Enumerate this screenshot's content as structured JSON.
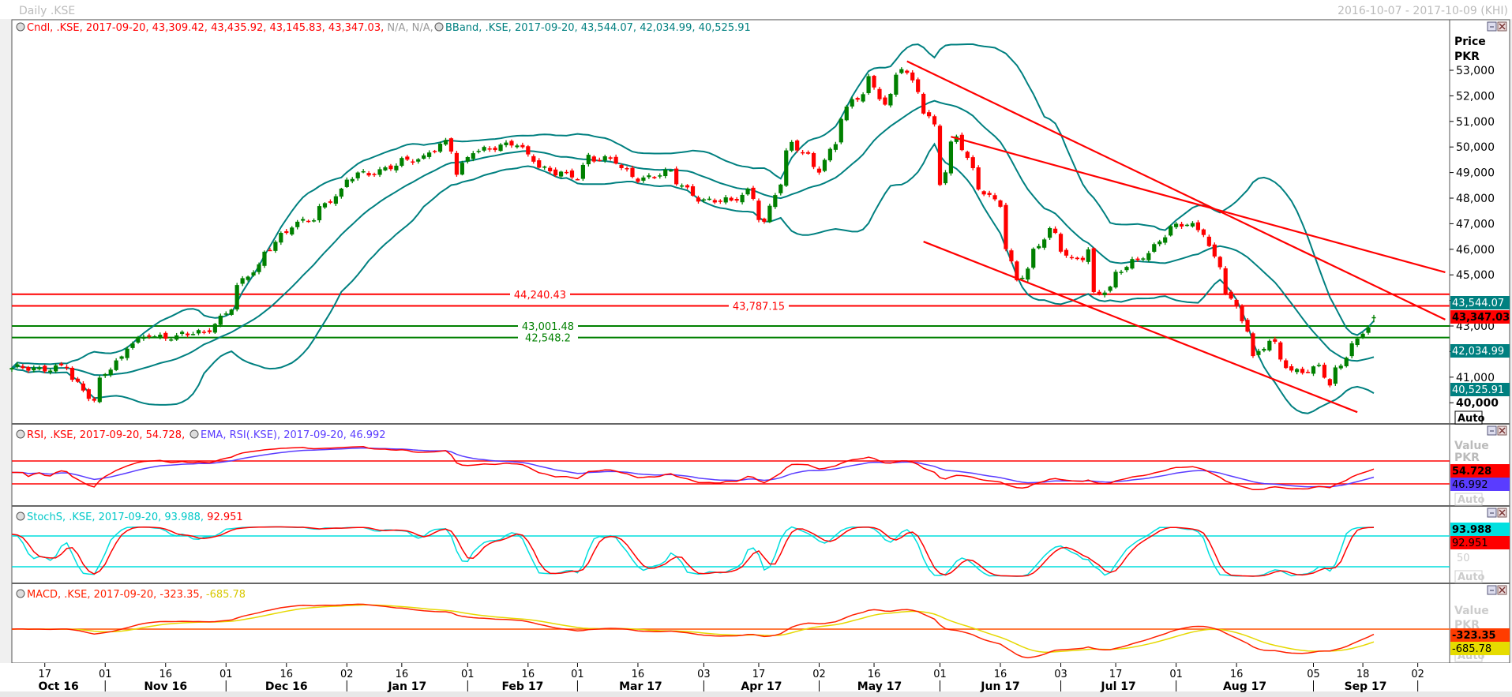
{
  "window": {
    "title": "Daily .KSE",
    "date_range": "2016-10-07 - 2017-10-09 (KHI)"
  },
  "colors": {
    "up": "#008000",
    "down": "#ff0000",
    "band": "#008080",
    "rsi": "#ff0000",
    "rsi_ema": "#5a3cff",
    "stoch_k": "#00dede",
    "stoch_d": "#ff0000",
    "macd": "#ff2000",
    "macd_signal": "#e6d800",
    "trend": "#ff0000",
    "support": "#008000"
  },
  "main_panel": {
    "legend_cndl": "Cndl, .KSE, 2017-09-20, 43,309.42, 43,435.92, 43,145.83, 43,347.03,",
    "legend_na": "N/A, N/A,",
    "legend_bband": "BBand, .KSE, 2017-09-20, 43,544.07, 42,034.99, 40,525.91",
    "axis_title": "Price",
    "axis_unit": "PKR",
    "auto_label": "Auto",
    "tags": {
      "bb_upper": "43,544.07",
      "last": "43,347.03",
      "bb_mid": "42,034.99",
      "bb_lower": "40,525.91"
    },
    "y_ticks": [
      "53,000",
      "52,000",
      "51,000",
      "50,000",
      "49,000",
      "48,000",
      "47,000",
      "46,000",
      "45,000",
      "44,000",
      "43,000",
      "42,000",
      "41,000",
      "40,000"
    ],
    "hlines": [
      {
        "label": "44,240.43",
        "value": 44240.43,
        "color": "red"
      },
      {
        "label": "43,787.15",
        "value": 43787.15,
        "color": "red"
      },
      {
        "label": "43,001.48",
        "value": 43001.48,
        "color": "green"
      },
      {
        "label": "42,548.2",
        "value": 42548.2,
        "color": "green"
      }
    ]
  },
  "rsi_panel": {
    "legend_rsi": "RSI, .KSE, 2017-09-20, 54.728,",
    "legend_ema": "EMA, RSI(.KSE), 2017-09-20, 46.992",
    "axis_title": "Value",
    "axis_unit": "PKR",
    "auto_label": "Auto",
    "tag_rsi": "54.728",
    "tag_ema": "46.992"
  },
  "stoch_panel": {
    "legend_k": "StochS, .KSE, 2017-09-20, 93.988,",
    "legend_d": "92.951",
    "tag_k": "93.988",
    "tag_d": "92.951",
    "mid_label": "50",
    "auto_label": "Auto"
  },
  "macd_panel": {
    "legend_macd": "MACD, .KSE, 2017-09-20, -323.35,",
    "legend_signal": "-685.78",
    "axis_title": "Value",
    "axis_unit": "PKR",
    "auto_label": "Auto",
    "tag_macd": "-323.35",
    "tag_signal": "-685.78"
  },
  "x_axis": {
    "minor": [
      {
        "label": "17",
        "date": "2016-10-17"
      },
      {
        "label": "01",
        "date": "2016-11-01"
      },
      {
        "label": "16",
        "date": "2016-11-16"
      },
      {
        "label": "01",
        "date": "2016-12-01"
      },
      {
        "label": "16",
        "date": "2016-12-16"
      },
      {
        "label": "02",
        "date": "2017-01-02"
      },
      {
        "label": "16",
        "date": "2017-01-16"
      },
      {
        "label": "01",
        "date": "2017-02-01"
      },
      {
        "label": "16",
        "date": "2017-02-16"
      },
      {
        "label": "01",
        "date": "2017-03-01"
      },
      {
        "label": "16",
        "date": "2017-03-16"
      },
      {
        "label": "03",
        "date": "2017-04-03"
      },
      {
        "label": "17",
        "date": "2017-04-17"
      },
      {
        "label": "02",
        "date": "2017-05-02"
      },
      {
        "label": "16",
        "date": "2017-05-16"
      },
      {
        "label": "01",
        "date": "2017-06-01"
      },
      {
        "label": "16",
        "date": "2017-06-16"
      },
      {
        "label": "03",
        "date": "2017-07-03"
      },
      {
        "label": "17",
        "date": "2017-07-17"
      },
      {
        "label": "01",
        "date": "2017-08-01"
      },
      {
        "label": "16",
        "date": "2017-08-16"
      },
      {
        "label": "05",
        "date": "2017-09-05"
      },
      {
        "label": "18",
        "date": "2017-09-18"
      },
      {
        "label": "02",
        "date": "2017-10-02"
      }
    ],
    "months": [
      {
        "label": "Oct 16",
        "start": "2016-10-07"
      },
      {
        "label": "Nov 16",
        "start": "2016-11-01"
      },
      {
        "label": "Dec 16",
        "start": "2016-12-01"
      },
      {
        "label": "Jan 17",
        "start": "2017-01-02"
      },
      {
        "label": "Feb 17",
        "start": "2017-02-01"
      },
      {
        "label": "Mar 17",
        "start": "2017-03-01"
      },
      {
        "label": "Apr 17",
        "start": "2017-04-03"
      },
      {
        "label": "May 17",
        "start": "2017-05-02"
      },
      {
        "label": "Jun 17",
        "start": "2017-06-01"
      },
      {
        "label": "Jul 17",
        "start": "2017-07-03"
      },
      {
        "label": "Aug 17",
        "start": "2017-08-01"
      },
      {
        "label": "Sep 17",
        "start": "2017-09-05"
      },
      {
        "label": "",
        "start": "2017-10-02"
      }
    ]
  },
  "chart_data": {
    "type": "candlestick",
    "title": "Daily .KSE",
    "instrument": ".KSE",
    "currency": "PKR",
    "x_range": [
      "2016-10-07",
      "2017-10-09"
    ],
    "ylim": [
      39200,
      54900
    ],
    "last_bar": {
      "date": "2017-09-20",
      "open": 43309.42,
      "high": 43435.92,
      "low": 43145.83,
      "close": 43347.03
    },
    "bollinger_last": {
      "upper": 43544.07,
      "middle": 42034.99,
      "lower": 40525.91
    },
    "rsi_last": 54.728,
    "rsi_ema_last": 46.992,
    "stoch_last": {
      "k": 93.988,
      "d": 92.951
    },
    "macd_last": {
      "macd": -323.35,
      "signal": -685.78
    },
    "rsi_levels": [
      70,
      30
    ],
    "stoch_levels": [
      80,
      20
    ],
    "close_anchors": [
      [
        "2016-10-07",
        41300
      ],
      [
        "2016-10-21",
        41400
      ],
      [
        "2016-10-28",
        40100
      ],
      [
        "2016-11-01",
        41240
      ],
      [
        "2016-11-11",
        42750
      ],
      [
        "2016-11-18",
        42500
      ],
      [
        "2016-11-28",
        42940
      ],
      [
        "2016-12-02",
        43680
      ],
      [
        "2016-12-07",
        45000
      ],
      [
        "2016-12-15",
        46500
      ],
      [
        "2016-12-23",
        47270
      ],
      [
        "2016-12-30",
        48200
      ],
      [
        "2017-01-04",
        48960
      ],
      [
        "2017-01-10",
        49100
      ],
      [
        "2017-01-19",
        49540
      ],
      [
        "2017-01-26",
        50160
      ],
      [
        "2017-01-30",
        48900
      ],
      [
        "2017-02-02",
        49900
      ],
      [
        "2017-02-14",
        50080
      ],
      [
        "2017-02-16",
        49700
      ],
      [
        "2017-02-23",
        48960
      ],
      [
        "2017-03-01",
        48800
      ],
      [
        "2017-03-03",
        49700
      ],
      [
        "2017-03-09",
        49500
      ],
      [
        "2017-03-16",
        48770
      ],
      [
        "2017-03-24",
        49000
      ],
      [
        "2017-03-31",
        48030
      ],
      [
        "2017-04-10",
        47800
      ],
      [
        "2017-04-13",
        48300
      ],
      [
        "2017-04-18",
        47070
      ],
      [
        "2017-04-20",
        48150
      ],
      [
        "2017-04-25",
        50100
      ],
      [
        "2017-05-02",
        49150
      ],
      [
        "2017-05-05",
        50100
      ],
      [
        "2017-05-10",
        51800
      ],
      [
        "2017-05-15",
        52730
      ],
      [
        "2017-05-18",
        51600
      ],
      [
        "2017-05-23",
        53100
      ],
      [
        "2017-05-26",
        52300
      ],
      [
        "2017-05-31",
        50850
      ],
      [
        "2017-06-01",
        48580
      ],
      [
        "2017-06-06",
        50400
      ],
      [
        "2017-06-09",
        49150
      ],
      [
        "2017-06-14",
        48030
      ],
      [
        "2017-06-16",
        47700
      ],
      [
        "2017-06-21",
        44800
      ],
      [
        "2017-06-29",
        46700
      ],
      [
        "2017-07-05",
        45560
      ],
      [
        "2017-07-10",
        46040
      ],
      [
        "2017-07-11",
        44260
      ],
      [
        "2017-07-14",
        44400
      ],
      [
        "2017-07-20",
        45560
      ],
      [
        "2017-07-25",
        45880
      ],
      [
        "2017-07-28",
        46500
      ],
      [
        "2017-08-03",
        47070
      ],
      [
        "2017-08-08",
        46700
      ],
      [
        "2017-08-10",
        45560
      ],
      [
        "2017-08-16",
        43680
      ],
      [
        "2017-08-21",
        41800
      ],
      [
        "2017-08-24",
        42400
      ],
      [
        "2017-08-30",
        41240
      ],
      [
        "2017-09-06",
        41400
      ],
      [
        "2017-09-08",
        40650
      ],
      [
        "2017-09-12",
        41400
      ],
      [
        "2017-09-14",
        42360
      ],
      [
        "2017-09-18",
        42800
      ],
      [
        "2017-09-20",
        43347.03
      ]
    ],
    "trend_lines": [
      {
        "from": [
          "2017-05-24",
          53350
        ],
        "to": [
          "2017-10-09",
          43250
        ]
      },
      {
        "from": [
          "2017-06-05",
          50400
        ],
        "to": [
          "2017-10-09",
          45100
        ]
      },
      {
        "from": [
          "2017-05-29",
          46300
        ],
        "to": [
          "2017-09-15",
          39630
        ]
      }
    ]
  }
}
